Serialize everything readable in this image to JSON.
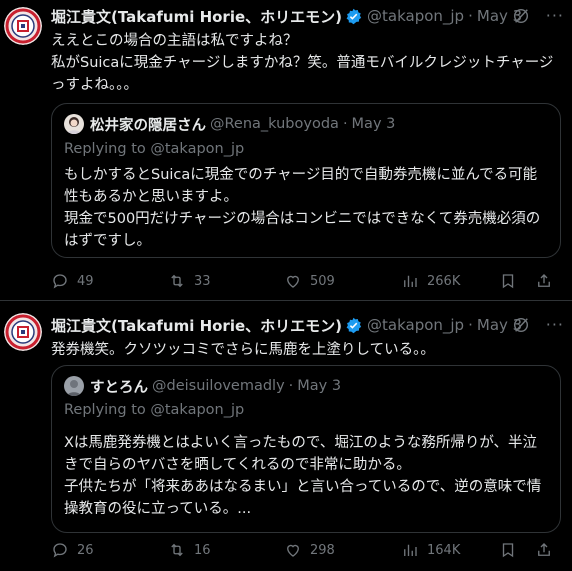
{
  "tweets": [
    {
      "author_name": "堀江貴文(Takafumi Horie、ホリエモン)",
      "handle": "@takapon_jp",
      "dot": "·",
      "date": "May 3",
      "more": "···",
      "text": "ええとこの場合の主語は私ですよね？\n私がSuicaに現金チャージしますかね？笑。普通モバイルクレジットチャージっすよね。。。",
      "quote": {
        "name": "松井家の隠居さん",
        "handle": "@Rena_kuboyoda",
        "dot": "·",
        "date": "May 3",
        "replying": "Replying to @takapon_jp",
        "text": "もしかするとSuicaに現金でのチャージ目的で自動券売機に並んでる可能性もあるかと思いますよ。\n現金で500円だけチャージの場合はコンビニではできなくて券売機必須のはずですし。"
      },
      "stats": {
        "replies": "49",
        "reposts": "33",
        "likes": "509",
        "views": "266K"
      }
    },
    {
      "author_name": "堀江貴文(Takafumi Horie、ホリエモン)",
      "handle": "@takapon_jp",
      "dot": "·",
      "date": "May 3",
      "more": "···",
      "text": "発券機笑。クソツッコミでさらに馬鹿を上塗りしている。。",
      "quote": {
        "name": "すとろん",
        "handle": "@deisuilovemadly",
        "dot": "·",
        "date": "May 3",
        "replying": "Replying to @takapon_jp",
        "text": "Xは馬鹿発券機とはよいく言ったもので、堀江のような務所帰りが、半泣きで自らのヤバさを晒してくれるので非常に助かる。\n子供たちが「将来ああはなるまい」と言い合っているので、逆の意味で情操教育の役に立っている。..."
      },
      "stats": {
        "replies": "26",
        "reposts": "16",
        "likes": "298",
        "views": "164K"
      }
    }
  ],
  "colors": {
    "background": "#000000",
    "text": "#e7e9ea",
    "muted": "#71767b",
    "verified": "#1d9bf0",
    "border": "#2f3336"
  }
}
